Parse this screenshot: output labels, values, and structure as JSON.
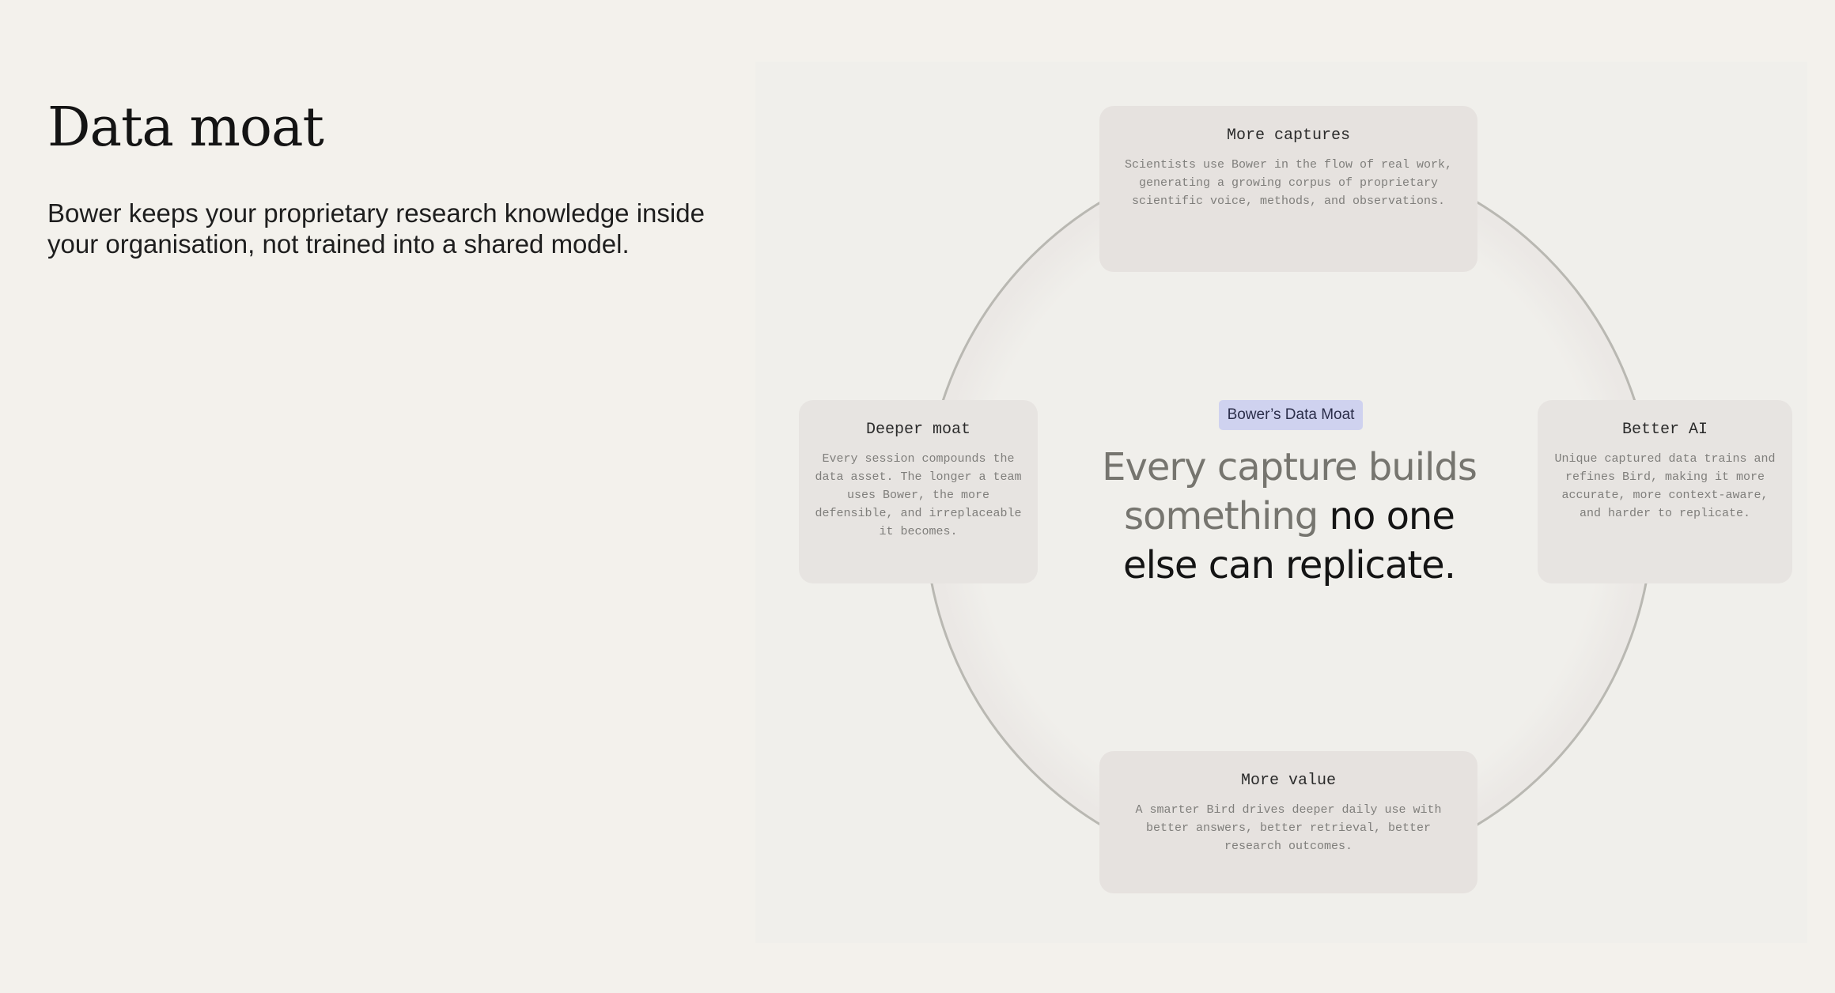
{
  "title": "Data moat",
  "subtitle": "Bower keeps your proprietary research knowledge inside your organisation, not trained into a shared model.",
  "diagram": {
    "badge": "Bower’s Data Moat",
    "center_text_muted": "Every capture builds something",
    "center_text_strong": "no one else can replicate.",
    "cards": {
      "top": {
        "title": "More captures",
        "description": "Scientists use Bower in the flow of real work, generating a growing corpus of proprietary scientific voice, methods, and observations."
      },
      "right": {
        "title": "Better AI",
        "description": "Unique captured data trains and refines Bird, making it more accurate, more context-aware, and harder to replicate."
      },
      "bottom": {
        "title": "More value",
        "description": "A smarter Bird drives deeper daily use with better answers, better retrieval, better research outcomes."
      },
      "left": {
        "title": "Deeper moat",
        "description": "Every session compounds the data asset. The longer a team uses Bower, the more defensible, and irreplaceable it becomes."
      }
    },
    "colors": {
      "background": "#f3f1ec",
      "panel": "#f0efeb",
      "card": "#e6e2df",
      "badge": "#cfd2ef",
      "ring_stroke": "#b9b8b2"
    }
  }
}
